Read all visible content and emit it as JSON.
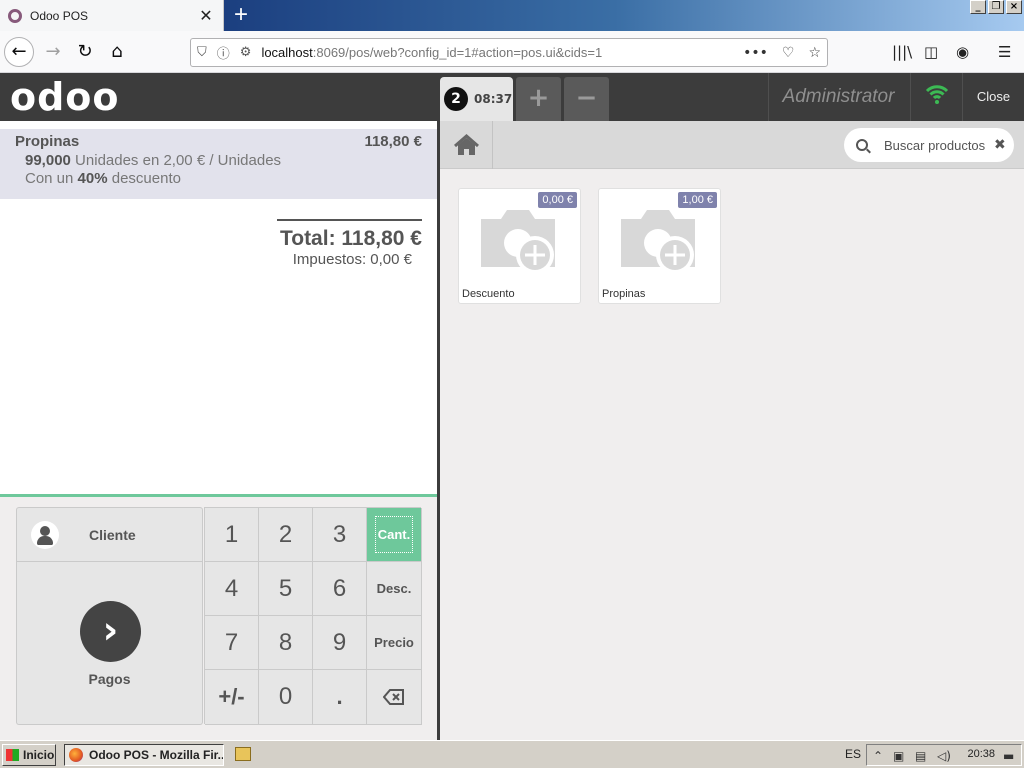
{
  "browser": {
    "tab_title": "Odoo POS",
    "url_host": "localhost",
    "url_rest": ":8069/pos/web?config_id=1#action=pos.ui&cids=1"
  },
  "header": {
    "logo": "odoo",
    "order_number": "2",
    "order_time": "08:37",
    "plus_label": "+",
    "minus_label": "−",
    "user": "Administrator",
    "close_label": "Close"
  },
  "order": {
    "lines": [
      {
        "product": "Propinas",
        "price": "118,80 €",
        "qty": "99,000",
        "unit_text": " Unidades en 2,00 € / Unidades",
        "discount_prefix": "Con un ",
        "discount_value": "40%",
        "discount_suffix": " descuento"
      }
    ],
    "total": "Total: 118,80 €",
    "taxes": "Impuestos: 0,00 €"
  },
  "actionpad": {
    "client_label": "Cliente",
    "pay_label": "Pagos"
  },
  "numpad": {
    "keys": [
      "1",
      "2",
      "3",
      "Cant.",
      "4",
      "5",
      "6",
      "Desc.",
      "7",
      "8",
      "9",
      "Precio",
      "+/-",
      "0",
      "."
    ]
  },
  "products_screen": {
    "search_placeholder": "Buscar productos",
    "products": [
      {
        "name": "Descuento",
        "price": "0,00 €"
      },
      {
        "name": "Propinas",
        "price": "1,00 €"
      }
    ]
  },
  "taskbar": {
    "start_label": "Inicio",
    "task_label": "Odoo POS - Mozilla Fir...",
    "lang": "ES",
    "clock": "20:38"
  },
  "colors": {
    "pos_dark": "#3c3c3c",
    "accent_green": "#6ec89b",
    "price_tag": "#7f82ac",
    "orderline_selected": "#e2e2ec"
  }
}
